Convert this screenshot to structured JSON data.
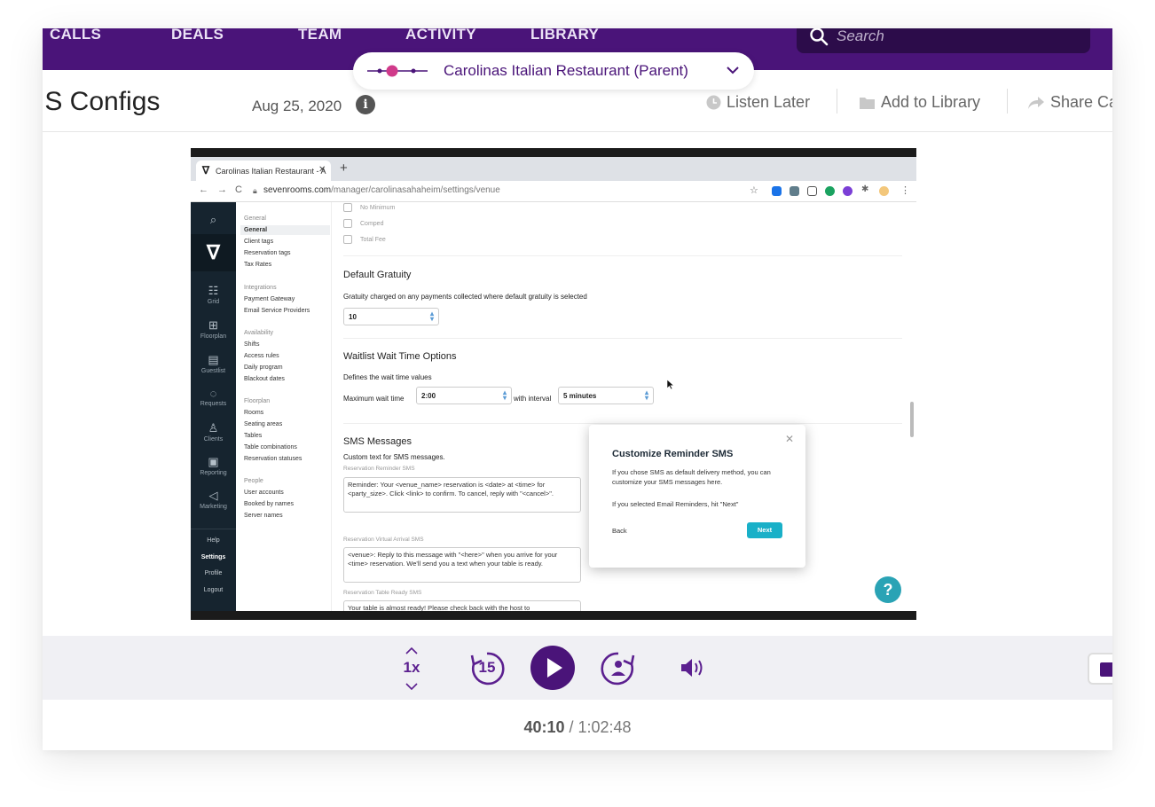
{
  "nav": {
    "items": [
      "CALLS",
      "DEALS",
      "TEAM",
      "ACTIVITY",
      "LIBRARY"
    ],
    "search_placeholder": "Search"
  },
  "parent_pill": {
    "label": "Carolinas Italian Restaurant (Parent)"
  },
  "header": {
    "title": "IS Configs",
    "date": "Aug 25, 2020",
    "actions": {
      "listen_later": "Listen Later",
      "add_to_library": "Add to Library",
      "share": "Share Ca"
    }
  },
  "browser": {
    "tab_title": "Carolinas Italian Restaurant - A",
    "url_host": "sevenrooms.com",
    "url_path": "/manager/carolinasahaheim/settings/venue"
  },
  "rail": {
    "items": [
      "Grid",
      "Floorplan",
      "Guestlist",
      "Requests",
      "Clients",
      "Reporting",
      "Marketing"
    ],
    "bottom": [
      "Help",
      "Settings",
      "Profile",
      "Logout"
    ]
  },
  "settings_nav": {
    "general": {
      "heading": "General",
      "items": [
        "General",
        "Client tags",
        "Reservation tags",
        "Tax Rates"
      ]
    },
    "integrations": {
      "heading": "Integrations",
      "items": [
        "Payment Gateway",
        "Email Service Providers"
      ]
    },
    "availability": {
      "heading": "Availability",
      "items": [
        "Shifts",
        "Access rules",
        "Daily program",
        "Blackout dates"
      ]
    },
    "floorplan": {
      "heading": "Floorplan",
      "items": [
        "Rooms",
        "Seating areas",
        "Tables",
        "Table combinations",
        "Reservation statuses"
      ]
    },
    "people": {
      "heading": "People",
      "items": [
        "User accounts",
        "Booked by names",
        "Server names"
      ]
    }
  },
  "content": {
    "checkboxes": [
      "No Minimum",
      "Comped",
      "Total Fee"
    ],
    "gratuity": {
      "heading": "Default Gratuity",
      "desc": "Gratuity charged on any payments collected where default gratuity is selected",
      "value": "10"
    },
    "waitlist": {
      "heading": "Waitlist Wait Time Options",
      "desc": "Defines the wait time values",
      "max_label": "Maximum wait time",
      "max_value": "2:00",
      "interval_label": "with interval",
      "interval_value": "5 minutes"
    },
    "sms": {
      "heading": "SMS Messages",
      "desc": "Custom text for SMS messages.",
      "reminder_label": "Reservation Reminder SMS",
      "reminder_text": "Reminder: Your <venue_name> reservation is <date> at <time> for <party_size>. Click <link> to confirm. To cancel, reply with \"<cancel>\".",
      "arrival_label": "Reservation Virtual Arrival SMS",
      "arrival_text": "<venue>: Reply to this message with \"<here>\" when you arrive for your <time> reservation. We'll send you a text when your table is ready.",
      "ready_label": "Reservation Table Ready SMS",
      "ready_text": "Your table is almost ready! Please check back with the host to"
    }
  },
  "popover": {
    "title": "Customize Reminder SMS",
    "body1": "If you chose SMS as default delivery method, you can customize your SMS messages here.",
    "body2": "If you selected Email Reminders, hit \"Next\"",
    "back": "Back",
    "next": "Next"
  },
  "player": {
    "speed": "1x",
    "skip_back": "15",
    "current_time": "40:10",
    "separator": " / ",
    "duration": "1:02:48"
  },
  "colors": {
    "brand_purple": "#4a1479",
    "accent_teal": "#19b0c8",
    "nav_dark": "#16242f"
  }
}
